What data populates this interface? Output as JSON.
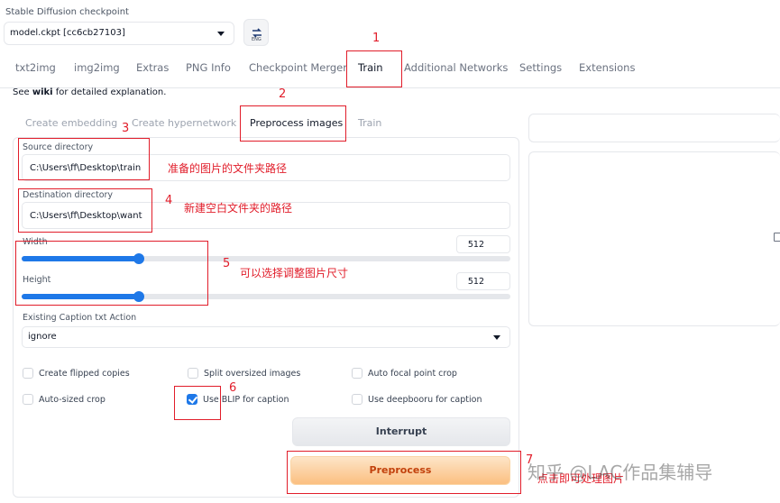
{
  "checkpoint": {
    "label": "Stable Diffusion checkpoint",
    "value": "model.ckpt [cc6cb27103]",
    "refresh_label": "ENG"
  },
  "tabs": [
    {
      "label": "txt2img"
    },
    {
      "label": "img2img"
    },
    {
      "label": "Extras"
    },
    {
      "label": "PNG Info"
    },
    {
      "label": "Checkpoint Merger"
    },
    {
      "label": "Train"
    },
    {
      "label": "Additional Networks"
    },
    {
      "label": "Settings"
    },
    {
      "label": "Extensions"
    }
  ],
  "wiki": {
    "pre": "See ",
    "link": "wiki",
    "post": " for detailed explanation."
  },
  "subtabs": [
    {
      "label": "Create embedding"
    },
    {
      "label": "Create hypernetwork"
    },
    {
      "label": "Preprocess images"
    },
    {
      "label": "Train"
    }
  ],
  "form": {
    "source_label": "Source directory",
    "source_value": "C:\\Users\\ff\\Desktop\\train",
    "dest_label": "Destination directory",
    "dest_value": "C:\\Users\\ff\\Desktop\\want",
    "width_label": "Width",
    "width_value": "512",
    "width_fraction": 0.24,
    "height_label": "Height",
    "height_value": "512",
    "height_fraction": 0.24,
    "caption_label": "Existing Caption txt Action",
    "caption_value": "ignore",
    "checkboxes": [
      {
        "label": "Create flipped copies",
        "checked": false
      },
      {
        "label": "Split oversized images",
        "checked": false
      },
      {
        "label": "Auto focal point crop",
        "checked": false
      },
      {
        "label": "Auto-sized crop",
        "checked": false
      },
      {
        "label": "Use BLIP for caption",
        "checked": true
      },
      {
        "label": "Use deepbooru for caption",
        "checked": false
      }
    ],
    "interrupt_label": "Interrupt",
    "preprocess_label": "Preprocess"
  },
  "annotations": {
    "n1": "1",
    "n2": "2",
    "n3": "3",
    "n4": "4",
    "n5": "5",
    "n6": "6",
    "n7": "7",
    "t3": "准备的图片的文件夹路径",
    "t4": "新建空白文件夹的路径",
    "t5": "可以选择调整图片尺寸",
    "t7": "点击即可处理图片"
  },
  "watermark": "知乎 @LAC作品集辅导",
  "colors": {
    "accent": "#1e78e8",
    "annotation": "#e11d2a",
    "primary_button": "#fbbf80"
  }
}
